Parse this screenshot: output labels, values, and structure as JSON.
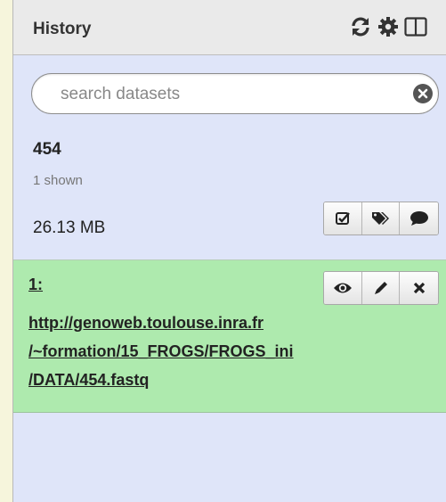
{
  "header": {
    "title": "History",
    "icons": [
      "refresh-icon",
      "gear-icon",
      "columns-icon"
    ]
  },
  "search": {
    "placeholder": "search datasets"
  },
  "history": {
    "name": "454",
    "shown": "1 shown",
    "size": "26.13 MB",
    "actions": [
      "checkbox-icon",
      "tags-icon",
      "comment-icon"
    ]
  },
  "dataset": {
    "hid": "1:",
    "title": "http://genoweb.toulouse.inra.fr\n/~formation/15_FROGS/FROGS_ini\n/DATA/454.fastq",
    "state_color": "#aeeaae",
    "actions": [
      "eye-icon",
      "pencil-icon",
      "delete-icon"
    ]
  }
}
